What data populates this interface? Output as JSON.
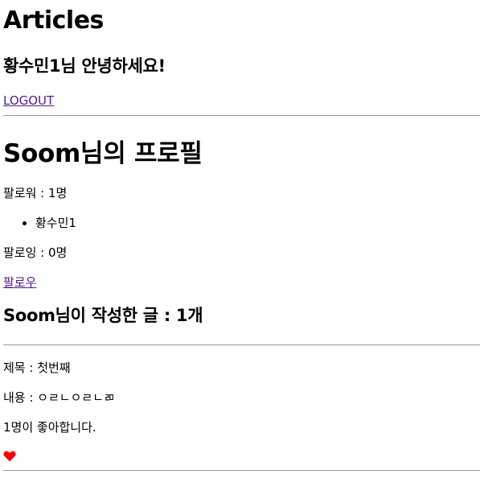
{
  "header": {
    "title": "Articles",
    "greeting": "황수민1님 안녕하세요!",
    "logout_label": "LOGOUT"
  },
  "profile": {
    "title": "Soom님의 프로필",
    "followers_text": "팔로워 : 1명",
    "followers": [
      "황수민1"
    ],
    "following_text": "팔로잉 : 0명",
    "follow_label": "팔로우"
  },
  "articles_section": {
    "heading": "Soom님이 작성한 글 : 1개",
    "items": [
      {
        "title_text": "제목 : 첫번째",
        "content_text": "내용 : ㅇㄹㄴㅇㄹㄴㄻ",
        "likes_text": "1명이 좋아합니다.",
        "like_icon": "heart-icon",
        "like_color": "#ff0000"
      }
    ]
  },
  "colors": {
    "link": "#551a8b",
    "heart": "#ff0000",
    "divider": "#9a9a9a"
  }
}
